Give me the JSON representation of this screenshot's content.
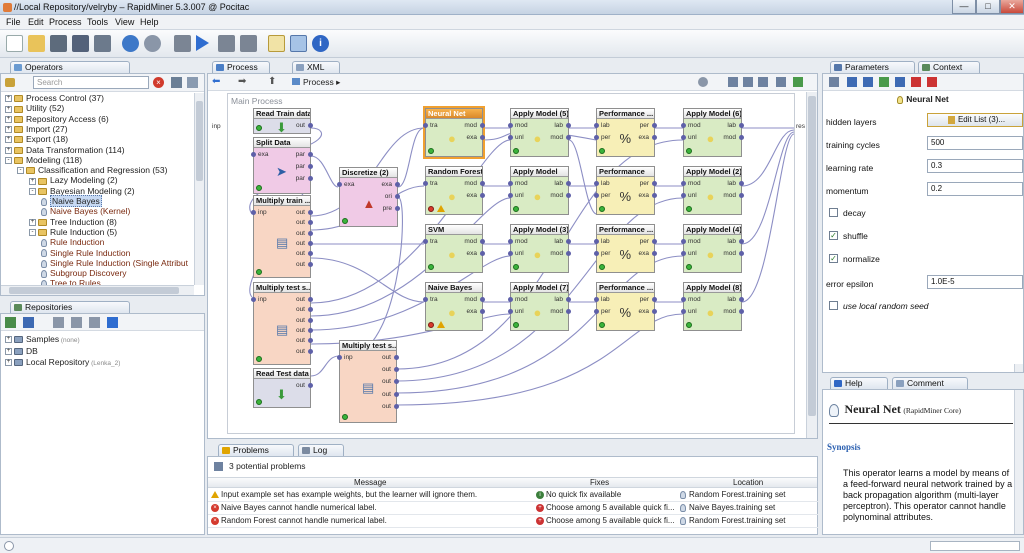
{
  "window": {
    "title": "//Local Repository/velryby – RapidMiner 5.3.007 @ Pocitac"
  },
  "menu": [
    "File",
    "Edit",
    "Process",
    "Tools",
    "View",
    "Help"
  ],
  "operators_panel": {
    "tab": "Operators",
    "search_placeholder": "Search",
    "tree": [
      {
        "label": "Process Control (37)",
        "level": 0,
        "type": "folder",
        "toggle": "+"
      },
      {
        "label": "Utility (52)",
        "level": 0,
        "type": "folder",
        "toggle": "+"
      },
      {
        "label": "Repository Access (6)",
        "level": 0,
        "type": "folder",
        "toggle": "+"
      },
      {
        "label": "Import (27)",
        "level": 0,
        "type": "folder",
        "toggle": "+"
      },
      {
        "label": "Export (18)",
        "level": 0,
        "type": "folder",
        "toggle": "+"
      },
      {
        "label": "Data Transformation (114)",
        "level": 0,
        "type": "folder",
        "toggle": "+"
      },
      {
        "label": "Modeling (118)",
        "level": 0,
        "type": "folder",
        "toggle": "-"
      },
      {
        "label": "Classification and Regression (53)",
        "level": 1,
        "type": "folder",
        "toggle": "-"
      },
      {
        "label": "Lazy Modeling (2)",
        "level": 2,
        "type": "folder",
        "toggle": "+"
      },
      {
        "label": "Bayesian Modeling (2)",
        "level": 2,
        "type": "folder",
        "toggle": "-"
      },
      {
        "label": "Naive Bayes",
        "level": 3,
        "type": "op",
        "selected": true
      },
      {
        "label": "Naive Bayes (Kernel)",
        "level": 3,
        "type": "op"
      },
      {
        "label": "Tree Induction (8)",
        "level": 2,
        "type": "folder",
        "toggle": "+"
      },
      {
        "label": "Rule Induction (5)",
        "level": 2,
        "type": "folder",
        "toggle": "-"
      },
      {
        "label": "Rule Induction",
        "level": 3,
        "type": "op"
      },
      {
        "label": "Single Rule Induction",
        "level": 3,
        "type": "op"
      },
      {
        "label": "Single Rule Induction (Single Attribut",
        "level": 3,
        "type": "op"
      },
      {
        "label": "Subgroup Discovery",
        "level": 3,
        "type": "op"
      },
      {
        "label": "Tree to Rules",
        "level": 3,
        "type": "op"
      }
    ]
  },
  "repositories_panel": {
    "tab": "Repositories",
    "items": [
      {
        "label": "Samples",
        "note": "(none)"
      },
      {
        "label": "DB",
        "note": ""
      },
      {
        "label": "Local Repository",
        "note": "(Lenka_2)"
      }
    ]
  },
  "process_panel": {
    "tabs": [
      "Process",
      "XML"
    ],
    "breadcrumb": "Process",
    "canvas_title": "Main Process",
    "left_port": "inp",
    "right_port": "res"
  },
  "operators": [
    {
      "id": "read-train",
      "title": "Read Train data",
      "color": "b",
      "status": "ok",
      "ports_in": [],
      "ports_out": [
        "out"
      ],
      "icon": "⬇",
      "icon_color": "#3a9a3a"
    },
    {
      "id": "split",
      "title": "Split Data",
      "color": "p",
      "status": "ok",
      "ports_in": [
        "exa"
      ],
      "ports_out": [
        "par",
        "par",
        "par"
      ],
      "icon": "➤",
      "icon_color": "#2e5fa6"
    },
    {
      "id": "multiply-train",
      "title": "Multiply train ...",
      "color": "o",
      "status": "ok",
      "ports_in": [
        "inp"
      ],
      "ports_out": [
        "out",
        "out",
        "out",
        "out",
        "out",
        "out"
      ],
      "icon": "▤",
      "icon_color": "#5577aa"
    },
    {
      "id": "multiply-test",
      "title": "Multiply test s...",
      "color": "o",
      "status": "ok",
      "ports_in": [
        "inp"
      ],
      "ports_out": [
        "out",
        "out",
        "out",
        "out",
        "out",
        "out"
      ],
      "icon": "▤",
      "icon_color": "#5577aa"
    },
    {
      "id": "read-test",
      "title": "Read Test data",
      "color": "b",
      "status": "ok",
      "ports_in": [],
      "ports_out": [
        "out"
      ],
      "icon": "⬇",
      "icon_color": "#3a9a3a"
    },
    {
      "id": "discretize",
      "title": "Discretize (2)",
      "color": "p",
      "status": "ok",
      "ports_in": [
        "exa"
      ],
      "ports_out": [
        "exa",
        "ori",
        "pre"
      ],
      "icon": "▲",
      "icon_color": "#c0392b"
    },
    {
      "id": "multiply-test-2",
      "title": "Multiply test s...",
      "color": "o",
      "status": "ok",
      "ports_in": [
        "inp"
      ],
      "ports_out": [
        "out",
        "out",
        "out",
        "out",
        "out"
      ],
      "icon": "▤",
      "icon_color": "#5577aa"
    },
    {
      "id": "neural-net",
      "title": "Neural Net",
      "color": "g",
      "status": "ok",
      "ports_in": [
        "tra"
      ],
      "ports_out": [
        "mod",
        "exa"
      ],
      "icon": "●",
      "icon_color": "#e8d35a",
      "selected": true
    },
    {
      "id": "random-forest",
      "title": "Random Forest",
      "color": "g",
      "status": "err",
      "ports_in": [
        "tra"
      ],
      "ports_out": [
        "mod",
        "exa"
      ],
      "icon": "●",
      "icon_color": "#e8d35a"
    },
    {
      "id": "svm",
      "title": "SVM",
      "color": "g",
      "status": "ok",
      "ports_in": [
        "tra"
      ],
      "ports_out": [
        "mod",
        "exa"
      ],
      "icon": "●",
      "icon_color": "#e8d35a"
    },
    {
      "id": "naive-bayes",
      "title": "Naive Bayes",
      "color": "g",
      "status": "err",
      "ports_in": [
        "tra"
      ],
      "ports_out": [
        "mod",
        "exa"
      ],
      "icon": "●",
      "icon_color": "#e8d35a"
    },
    {
      "id": "apply-5",
      "title": "Apply Model (5)",
      "color": "g",
      "status": "ok",
      "ports_in": [
        "mod",
        "unl"
      ],
      "ports_out": [
        "lab",
        "mod"
      ],
      "icon": "●",
      "icon_color": "#e8d35a"
    },
    {
      "id": "apply-1",
      "title": "Apply Model",
      "color": "g",
      "status": "ok",
      "ports_in": [
        "mod",
        "unl"
      ],
      "ports_out": [
        "lab",
        "mod"
      ],
      "icon": "●",
      "icon_color": "#e8d35a"
    },
    {
      "id": "apply-3",
      "title": "Apply Model (3)",
      "color": "g",
      "status": "ok",
      "ports_in": [
        "mod",
        "unl"
      ],
      "ports_out": [
        "lab",
        "mod"
      ],
      "icon": "●",
      "icon_color": "#e8d35a"
    },
    {
      "id": "apply-7",
      "title": "Apply Model (7)",
      "color": "g",
      "status": "ok",
      "ports_in": [
        "mod",
        "unl"
      ],
      "ports_out": [
        "lab",
        "mod"
      ],
      "icon": "●",
      "icon_color": "#e8d35a"
    },
    {
      "id": "perf-1",
      "title": "Performance ...",
      "color": "y",
      "status": "ok",
      "ports_in": [
        "lab",
        "per"
      ],
      "ports_out": [
        "per",
        "exa"
      ],
      "icon": "%",
      "icon_color": "#333"
    },
    {
      "id": "perf-2",
      "title": "Performance",
      "color": "y",
      "status": "ok",
      "ports_in": [
        "lab",
        "per"
      ],
      "ports_out": [
        "per",
        "exa"
      ],
      "icon": "%",
      "icon_color": "#333"
    },
    {
      "id": "perf-3",
      "title": "Performance ...",
      "color": "y",
      "status": "ok",
      "ports_in": [
        "lab",
        "per"
      ],
      "ports_out": [
        "per",
        "exa"
      ],
      "icon": "%",
      "icon_color": "#333"
    },
    {
      "id": "perf-4",
      "title": "Performance ...",
      "color": "y",
      "status": "ok",
      "ports_in": [
        "lab",
        "per"
      ],
      "ports_out": [
        "per",
        "exa"
      ],
      "icon": "%",
      "icon_color": "#333"
    },
    {
      "id": "apply-6",
      "title": "Apply Model (6)",
      "color": "g",
      "status": "ok",
      "ports_in": [
        "mod",
        "unl"
      ],
      "ports_out": [
        "lab",
        "mod"
      ],
      "icon": "●",
      "icon_color": "#e8d35a"
    },
    {
      "id": "apply-2",
      "title": "Apply Model (2)",
      "color": "g",
      "status": "ok",
      "ports_in": [
        "mod",
        "unl"
      ],
      "ports_out": [
        "lab",
        "mod"
      ],
      "icon": "●",
      "icon_color": "#e8d35a"
    },
    {
      "id": "apply-4",
      "title": "Apply Model (4)",
      "color": "g",
      "status": "ok",
      "ports_in": [
        "mod",
        "unl"
      ],
      "ports_out": [
        "lab",
        "mod"
      ],
      "icon": "●",
      "icon_color": "#e8d35a"
    },
    {
      "id": "apply-8",
      "title": "Apply Model (8)",
      "color": "g",
      "status": "ok",
      "ports_in": [
        "mod",
        "unl"
      ],
      "ports_out": [
        "lab",
        "mod"
      ],
      "icon": "●",
      "icon_color": "#e8d35a"
    }
  ],
  "problems_panel": {
    "tabs": [
      "Problems",
      "Log"
    ],
    "summary": "3 potential problems",
    "columns": [
      "Message",
      "Fixes",
      "Location"
    ],
    "rows": [
      {
        "severity": "warning",
        "message": "Input example set has example weights, but the learner will ignore them.",
        "fix_icon": "info",
        "fix": "No quick fix available",
        "location": "Random Forest.training set"
      },
      {
        "severity": "error",
        "message": "Naive Bayes cannot handle numerical label.",
        "fix_icon": "error",
        "fix": "Choose among 5 available quick fi...",
        "location": "Naive Bayes.training set"
      },
      {
        "severity": "error",
        "message": "Random Forest cannot handle numerical label.",
        "fix_icon": "error",
        "fix": "Choose among 5 available quick fi...",
        "location": "Random Forest.training set"
      }
    ]
  },
  "parameters_panel": {
    "tabs": [
      "Parameters",
      "Context"
    ],
    "operator_title": "Neural Net",
    "params": [
      {
        "label": "hidden layers",
        "kind": "button",
        "value": "Edit List (3)..."
      },
      {
        "label": "training cycles",
        "kind": "input",
        "value": "500"
      },
      {
        "label": "learning rate",
        "kind": "input",
        "value": "0.3"
      },
      {
        "label": "momentum",
        "kind": "input",
        "value": "0.2"
      },
      {
        "label": "decay",
        "kind": "check",
        "checked": false
      },
      {
        "label": "shuffle",
        "kind": "check",
        "checked": true
      },
      {
        "label": "normalize",
        "kind": "check",
        "checked": true
      },
      {
        "label": "error epsilon",
        "kind": "input",
        "value": "1.0E-5"
      },
      {
        "label": "use local random seed",
        "kind": "check",
        "checked": false
      }
    ]
  },
  "help_panel": {
    "tabs": [
      "Help",
      "Comment"
    ],
    "title": "Neural Net",
    "subtitle": "(RapidMiner Core)",
    "section": "Synopsis",
    "text": "This operator learns a model by means of a feed-forward neural network trained by a back propagation algorithm (multi-layer perceptron). This operator cannot handle polynominal attributes."
  }
}
